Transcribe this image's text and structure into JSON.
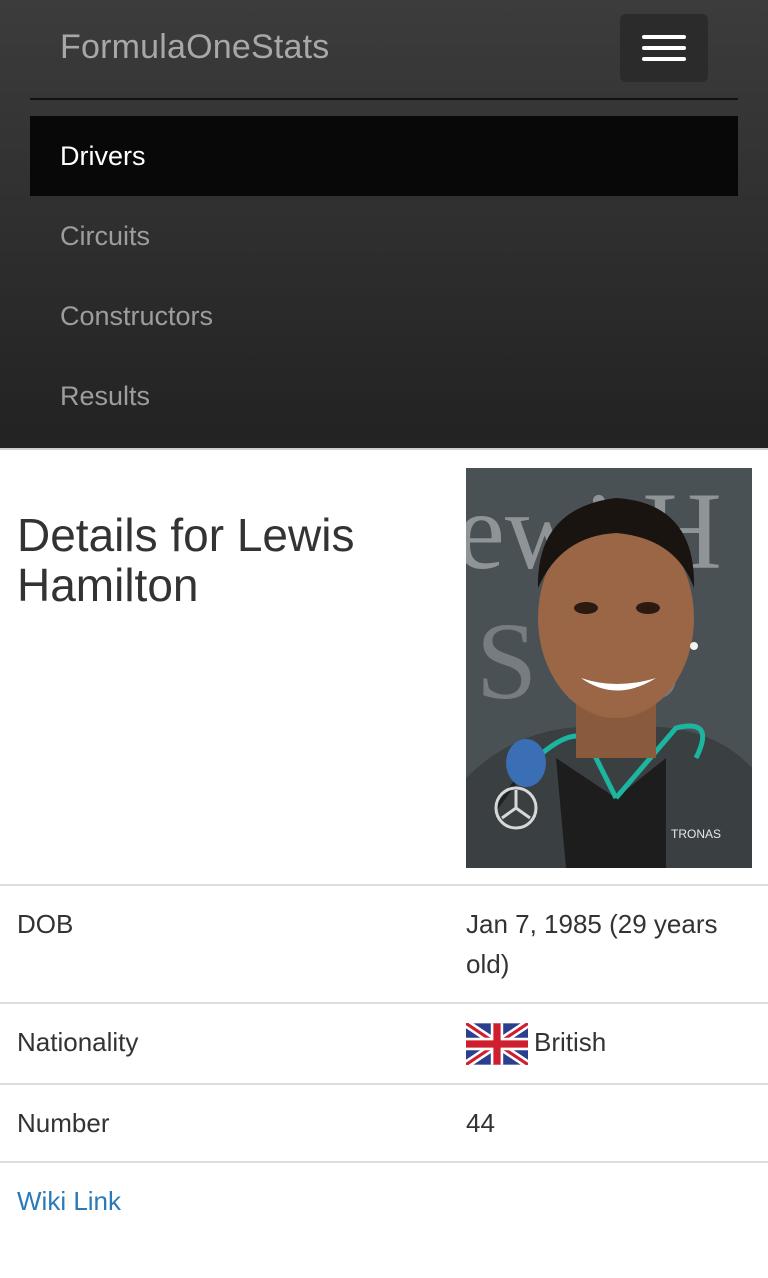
{
  "navbar": {
    "brand": "FormulaOneStats",
    "toggle_icon": "hamburger-icon",
    "menu": [
      {
        "label": "Drivers",
        "active": true
      },
      {
        "label": "Circuits",
        "active": false
      },
      {
        "label": "Constructors",
        "active": false
      },
      {
        "label": "Results",
        "active": false
      }
    ]
  },
  "page": {
    "title": "Details for Lewis Hamilton",
    "photo": "driver-photo"
  },
  "details": [
    {
      "label": "DOB",
      "value": "Jan 7, 1985 (29 years old)"
    },
    {
      "label": "Nationality",
      "value": "British",
      "icon": "uk-flag-icon"
    },
    {
      "label": "Number",
      "value": "44"
    }
  ],
  "wiki_link": "Wiki Link",
  "colors": {
    "navbar": "#222222",
    "active_item": "#080808",
    "link": "#2a7ab8"
  }
}
